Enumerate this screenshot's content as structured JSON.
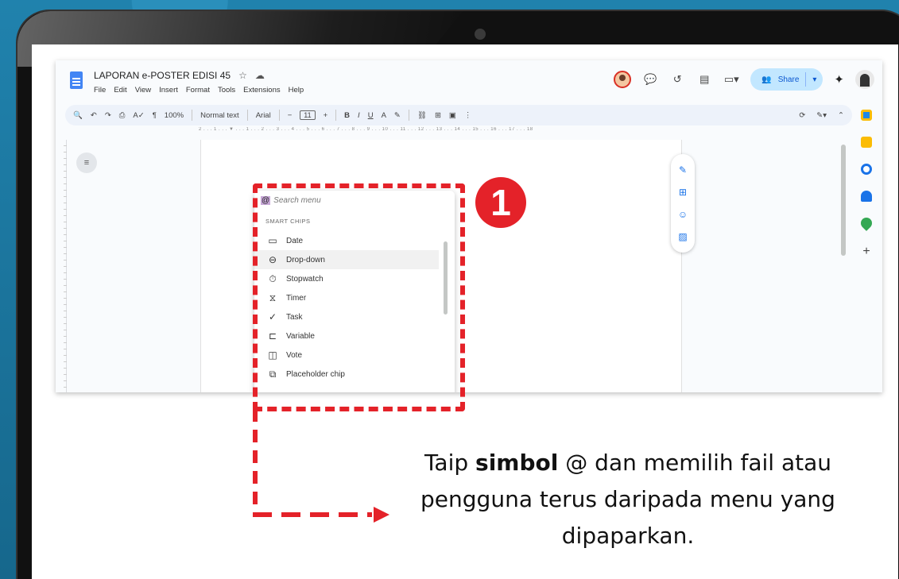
{
  "doc": {
    "title": "LAPORAN e-POSTER EDISI 45",
    "menu": [
      "File",
      "Edit",
      "View",
      "Insert",
      "Format",
      "Tools",
      "Extensions",
      "Help"
    ],
    "share_label": "Share"
  },
  "toolbar": {
    "zoom": "100%",
    "style": "Normal text",
    "font": "Arial",
    "font_size": "11"
  },
  "ruler_text": "2 . . . 1 . . . ▼ . . . 1 . . . 2 . . . 3 . . . 4 . . . 5 . . . 6 . . . 7 . . . 8 . . . 9 . . . 10 . . . 11 . . . 12 . . . 13 . . . 14 . . . 15 . . . 16 . . . 17 . . . 18",
  "chips": {
    "search_placeholder": "Search menu",
    "at": "@",
    "header": "SMART CHIPS",
    "items": [
      {
        "label": "Date",
        "icon": "📅"
      },
      {
        "label": "Drop-down",
        "icon": "⊖"
      },
      {
        "label": "Stopwatch",
        "icon": "⏱"
      },
      {
        "label": "Timer",
        "icon": "⧖"
      },
      {
        "label": "Task",
        "icon": "✓"
      },
      {
        "label": "Variable",
        "icon": "⊏"
      },
      {
        "label": "Vote",
        "icon": "◫"
      },
      {
        "label": "Placeholder chip",
        "icon": "⧉"
      }
    ]
  },
  "annotation": {
    "step_number": "1",
    "caption_prefix": "Taip ",
    "caption_bold": "simbol",
    "caption_rest_line1": " @ dan memilih fail atau",
    "caption_line2": "pengguna terus daripada menu yang",
    "caption_line3": "dipaparkan."
  },
  "colors": {
    "accent_red": "#e42229",
    "share_bg": "#c2e7ff",
    "background": "#1a6f96"
  }
}
